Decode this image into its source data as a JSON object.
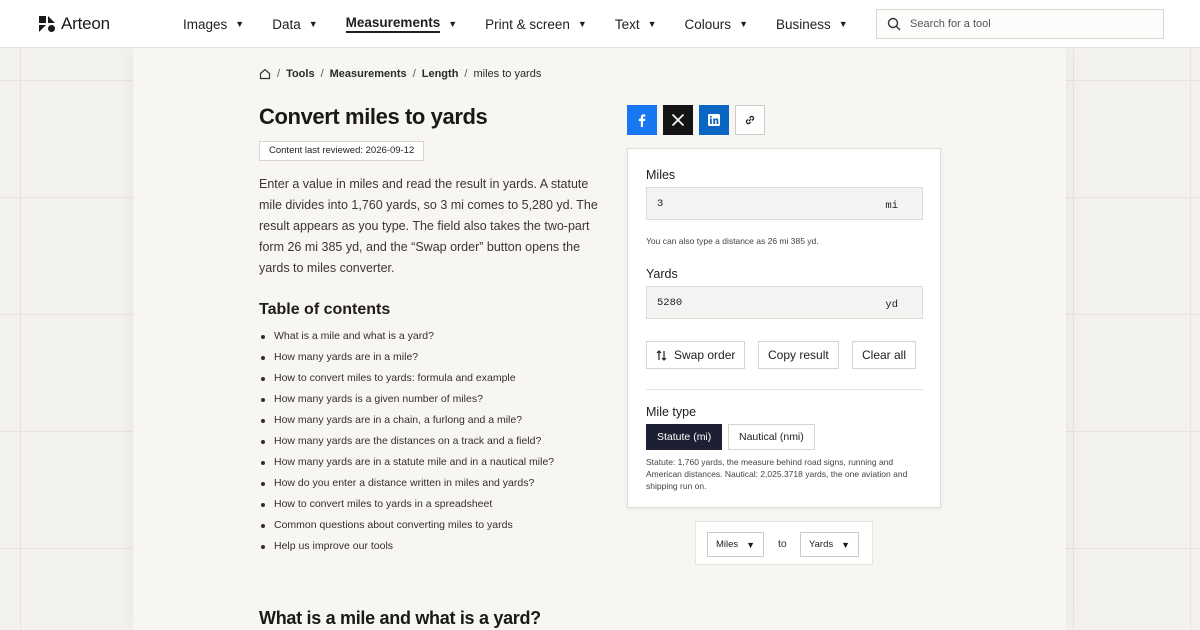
{
  "header": {
    "logo_text": "Arteon",
    "nav": [
      {
        "label": "Images",
        "active": false
      },
      {
        "label": "Data",
        "active": false
      },
      {
        "label": "Measurements",
        "active": true
      },
      {
        "label": "Print & screen",
        "active": false
      },
      {
        "label": "Text",
        "active": false
      },
      {
        "label": "Colours",
        "active": false
      },
      {
        "label": "Business",
        "active": false
      }
    ],
    "search_placeholder": "Search for a tool"
  },
  "breadcrumb": {
    "items": [
      "Tools",
      "Measurements",
      "Length"
    ],
    "current": "miles to yards"
  },
  "page": {
    "title": "Convert miles to yards",
    "review_label": "Content last reviewed:",
    "review_date": "2026-09-12",
    "intro": "Enter a value in miles and read the result in yards. A statute mile divides into 1,760 yards, so 3 mi comes to 5,280 yd. The result appears as you type. The field also takes the two-part form 26 mi 385 yd, and the “Swap order” button opens the yards to miles converter.",
    "toc_title": "Table of contents",
    "toc": [
      "What is a mile and what is a yard?",
      "How many yards are in a mile?",
      "How to convert miles to yards: formula and example",
      "How many yards is a given number of miles?",
      "How many yards are in a chain, a furlong and a mile?",
      "How many yards are the distances on a track and a field?",
      "How many yards are in a statute mile and in a nautical mile?",
      "How do you enter a distance written in miles and yards?",
      "How to convert miles to yards in a spreadsheet",
      "Common questions about converting miles to yards",
      "Help us improve our tools"
    ],
    "next_heading": "What is a mile and what is a yard?"
  },
  "converter": {
    "miles_label": "Miles",
    "miles_value": "3",
    "miles_unit": "mi",
    "miles_hint": "You can also type a distance as 26 mi 385 yd.",
    "yards_label": "Yards",
    "yards_value": "5280",
    "yards_unit": "yd",
    "swap_label": "Swap order",
    "copy_label": "Copy result",
    "clear_label": "Clear all",
    "mile_type_label": "Mile type",
    "statute_label": "Statute (mi)",
    "nautical_label": "Nautical (nmi)",
    "mile_type_note": "Statute: 1,760 yards, the measure behind road signs, running and American distances. Nautical: 2,025.3718 yards, the one aviation and shipping run on."
  },
  "unit_selector": {
    "from": "Miles",
    "to_word": "to",
    "to": "Yards"
  },
  "colors": {
    "facebook": "#1877f2",
    "x": "#141414",
    "linkedin": "#0a66c2",
    "segment_active": "#1d2033"
  }
}
